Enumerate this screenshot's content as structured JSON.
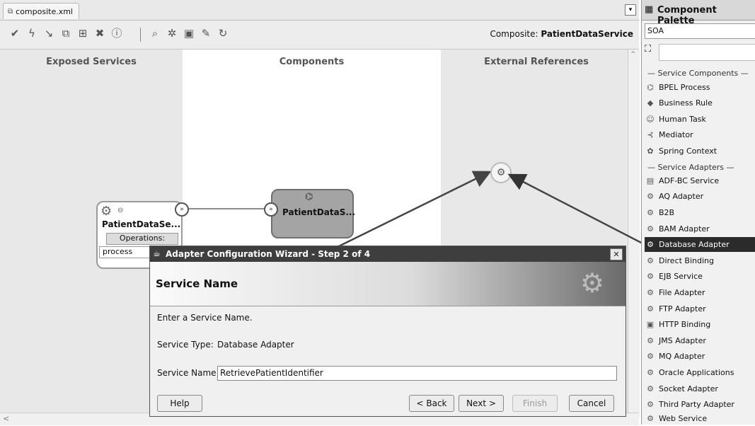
{
  "tab": {
    "filename": "composite.xml"
  },
  "toolbar": {
    "composite_label": "Composite:",
    "composite_name": "PatientDataService"
  },
  "lanes": {
    "exposed": "Exposed Services",
    "components": "Components",
    "external": "External References"
  },
  "service": {
    "name": "PatientDataSe...",
    "operations_header": "Operations:",
    "operation": "process"
  },
  "component": {
    "name": "PatientDataS..."
  },
  "dialog": {
    "title": "Adapter Configuration Wizard - Step 2 of 4",
    "heading": "Service Name",
    "instruction": "Enter a Service Name.",
    "service_type_label": "Service Type:",
    "service_type_value": "Database Adapter",
    "service_name_label": "Service Name:",
    "service_name_value": "RetrievePatientIdentifier",
    "buttons": {
      "help": "Help",
      "back": "< Back",
      "next": "Next >",
      "finish": "Finish",
      "cancel": "Cancel"
    }
  },
  "palette": {
    "title": "Component Palette",
    "category": "SOA",
    "section1": "Service Components",
    "components": [
      "BPEL Process",
      "Business Rule",
      "Human Task",
      "Mediator",
      "Spring Context"
    ],
    "section2": "Service Adapters",
    "adapters": [
      "ADF-BC Service",
      "AQ Adapter",
      "B2B",
      "BAM Adapter",
      "Database Adapter",
      "Direct Binding",
      "EJB Service",
      "File Adapter",
      "FTP Adapter",
      "HTTP Binding",
      "JMS Adapter",
      "MQ Adapter",
      "Oracle Applications",
      "Socket Adapter",
      "Third Party Adapter",
      "Web Service"
    ],
    "selected": "Database Adapter"
  }
}
